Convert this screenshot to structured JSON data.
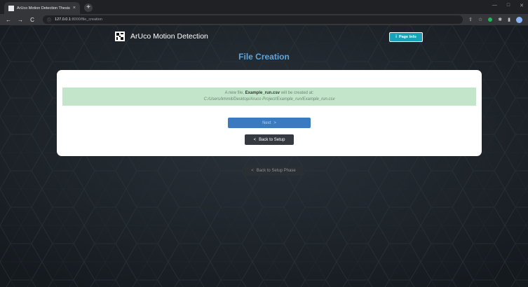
{
  "browser": {
    "tab_title": "ArUco Motion Detection Thesis",
    "tab_close": "×",
    "new_tab": "+",
    "url_host": "127.0.0.1",
    "url_rest": ":8000/file_creation",
    "back_glyph": "←",
    "forward_glyph": "→",
    "reload_glyph": "C",
    "window_controls": [
      "—",
      "□",
      "✕"
    ]
  },
  "header": {
    "brand": "ArUco Motion Detection",
    "page_info_label": "Page Info",
    "page_info_icon": "i"
  },
  "main": {
    "title": "File Creation",
    "alert": {
      "prefix": "A new file, ",
      "filename": "Example_run.csv",
      "suffix": " will be created at:",
      "path": "C:/Users/kmmit/Desktop/Aruco Project/Example_run/Example_run.csv"
    },
    "next_label": "Next",
    "next_glyph": ">",
    "back_setup_label": "Back to Setup",
    "back_glyph": "<",
    "back_phase_label": "Back to Setup Phase"
  },
  "colors": {
    "accent": "#5aa7e0",
    "info_button": "#18a2b8",
    "next_button": "#3a7ac1",
    "alert_bg": "#c3e5c9",
    "dark_button": "#353a40"
  }
}
